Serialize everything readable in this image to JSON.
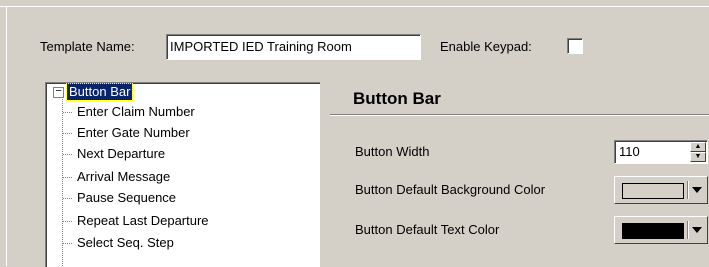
{
  "template": {
    "name_label": "Template Name:",
    "name_value": "IMPORTED IED Training Room",
    "keypad_label": "Enable Keypad:",
    "keypad_checked": false
  },
  "tree": {
    "root": {
      "label": "Button Bar",
      "expander": "−"
    },
    "items": [
      "Enter Claim Number",
      "Enter Gate Number",
      "Next Departure",
      "Arrival Message",
      "Pause Sequence",
      "Repeat Last Departure",
      "Select Seq. Step"
    ]
  },
  "panel": {
    "title": "Button Bar",
    "button_width_label": "Button Width",
    "button_width_value": "110",
    "bg_color_label": "Button Default Background Color",
    "bg_color_value": "#d4d0c8",
    "text_color_label": "Button Default Text Color",
    "text_color_value": "#000000"
  },
  "icons": {
    "spin_up": "up-arrow-icon",
    "spin_down": "down-arrow-icon",
    "dropdown": "chevron-down-icon"
  }
}
